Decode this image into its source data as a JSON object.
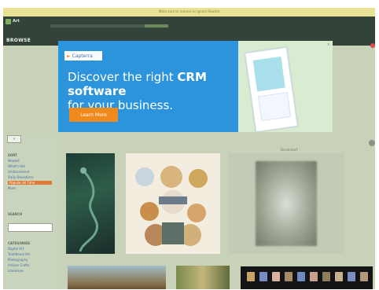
{
  "window": {
    "notice": "Make sure to remove or ignore Rewrite"
  },
  "nav": {
    "brand": "Art",
    "section_title": "BROWSE"
  },
  "ad": {
    "brand": "Capterra",
    "headline_pre": "Discover the right ",
    "headline_bold": "CRM software",
    "headline_post": "for your business.",
    "cta": "Learn More",
    "close": "×"
  },
  "sidebar": {
    "toggle": "«",
    "sort_heading": "SORT",
    "sort_items": [
      "Newest",
      "What's Hot",
      "Undiscovered",
      "Daily Deviations",
      "Popular All Time",
      "More"
    ],
    "active_sort_index": 4,
    "search_heading": "SEARCH",
    "search_value": "",
    "categories_heading": "CATEGORIES",
    "category_items": [
      "Digital Art",
      "Traditional Art",
      "Photography",
      "Artisan Crafts",
      "Literature"
    ]
  },
  "main": {
    "thumb_label": "Deviantart"
  }
}
